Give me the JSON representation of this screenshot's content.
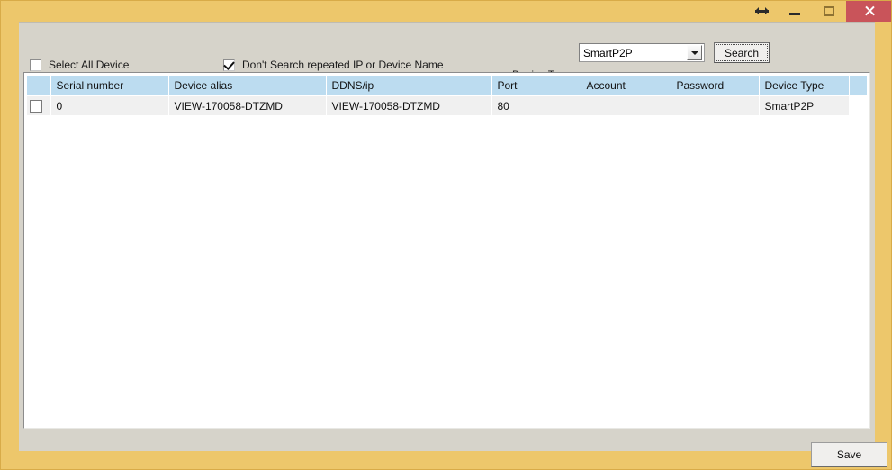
{
  "window": {
    "frame_color": "#edc76b",
    "client_color": "#d6d3ca",
    "close_color": "#c9545a"
  },
  "titlebar": {
    "title": "",
    "buttons": [
      {
        "name": "resize-icon",
        "label": "↔"
      },
      {
        "name": "minimize-button",
        "label": "–"
      },
      {
        "name": "maximize-button",
        "label": "□"
      },
      {
        "name": "close-button",
        "label": "✕"
      }
    ]
  },
  "toolbar": {
    "select_all_label": "Select All Device",
    "select_all_checked": false,
    "no_repeat_label": "Don't Search repeated IP or Device Name",
    "no_repeat_checked": true,
    "device_type_label": "Device Type",
    "device_type_value": "SmartP2P",
    "device_type_options": [
      "SmartP2P"
    ],
    "search_label": "Search"
  },
  "grid": {
    "columns": [
      "",
      "Serial number",
      "Device alias",
      "DDNS/ip",
      "Port",
      "Account",
      "Password",
      "Device Type",
      ""
    ],
    "rows": [
      {
        "checked": false,
        "serial_number": "0",
        "device_alias": "VIEW-170058-DTZMD",
        "ddns_ip": "VIEW-170058-DTZMD",
        "port": "80",
        "account": "",
        "password": "",
        "device_type": "SmartP2P"
      }
    ]
  },
  "footer": {
    "save_label": "Save"
  }
}
